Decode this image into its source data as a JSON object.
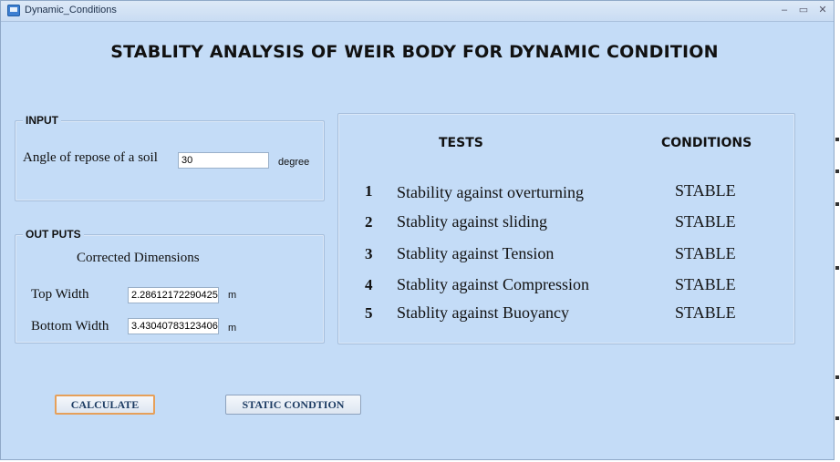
{
  "window": {
    "title": "Dynamic_Conditions",
    "controls": {
      "minimize": "–",
      "maximize": "▭",
      "close": "✕"
    }
  },
  "heading": "STABLITY ANALYSIS OF WEIR BODY FOR DYNAMIC CONDITION",
  "input_group": {
    "label": "INPUT",
    "angle_label": "Angle of repose of a soil",
    "angle_value": "30",
    "angle_unit": "degree"
  },
  "output_group": {
    "label": "OUT PUTS",
    "subtitle": "Corrected Dimensions",
    "top_width_label": "Top Width",
    "top_width_value": "2.28612172290425",
    "top_width_unit": "m",
    "bottom_width_label": "Bottom Width",
    "bottom_width_value": "3.43040783123406",
    "bottom_width_unit": "m"
  },
  "results": {
    "tests_header": "TESTS",
    "conditions_header": "CONDITIONS",
    "rows": [
      {
        "num": "1",
        "test": "Stability against overturning",
        "condition": "STABLE"
      },
      {
        "num": "2",
        "test": "Stablity against sliding",
        "condition": "STABLE"
      },
      {
        "num": "3",
        "test": "Stablity against Tension",
        "condition": "STABLE"
      },
      {
        "num": "4",
        "test": "Stablity against Compression",
        "condition": "STABLE"
      },
      {
        "num": "5",
        "test": "Stablity against Buoyancy",
        "condition": "STABLE"
      }
    ]
  },
  "buttons": {
    "calculate": "CALCULATE",
    "static": "STATIC CONDTION"
  }
}
